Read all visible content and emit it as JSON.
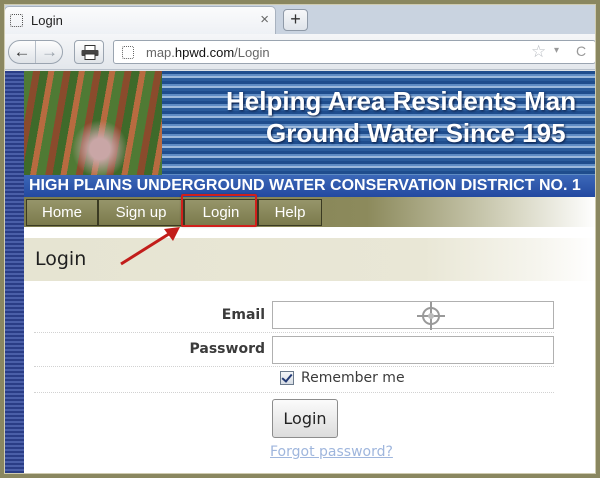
{
  "browser": {
    "tab_title": "Login",
    "tab_close": "×",
    "new_tab": "+",
    "back_glyph": "←",
    "forward_glyph": "→",
    "url_prefix": "map.",
    "url_domain": "hpwd.com",
    "url_path": "/Login",
    "star_glyph": "☆",
    "dropdown_glyph": "▾",
    "reload_glyph": "C"
  },
  "banner": {
    "headline_line1": "Helping Area Residents Man",
    "headline_line2": "Ground Water Since 195"
  },
  "district_name": "HIGH PLAINS UNDERGROUND WATER CONSERVATION DISTRICT NO. 1",
  "nav": {
    "items": [
      {
        "label": "Home"
      },
      {
        "label": "Sign up"
      },
      {
        "label": "Login"
      },
      {
        "label": "Help"
      }
    ]
  },
  "login": {
    "heading": "Login",
    "email_label": "Email",
    "email_value": "",
    "password_label": "Password",
    "password_value": "",
    "remember_label": "Remember me",
    "remember_checked": true,
    "submit_label": "Login",
    "forgot_label": "Forgot password?"
  },
  "colors": {
    "annotation_red": "#d0201c",
    "nav_olive": "#8c8a5c",
    "district_blue": "#2d55a8",
    "link": "#9fb6dd"
  }
}
